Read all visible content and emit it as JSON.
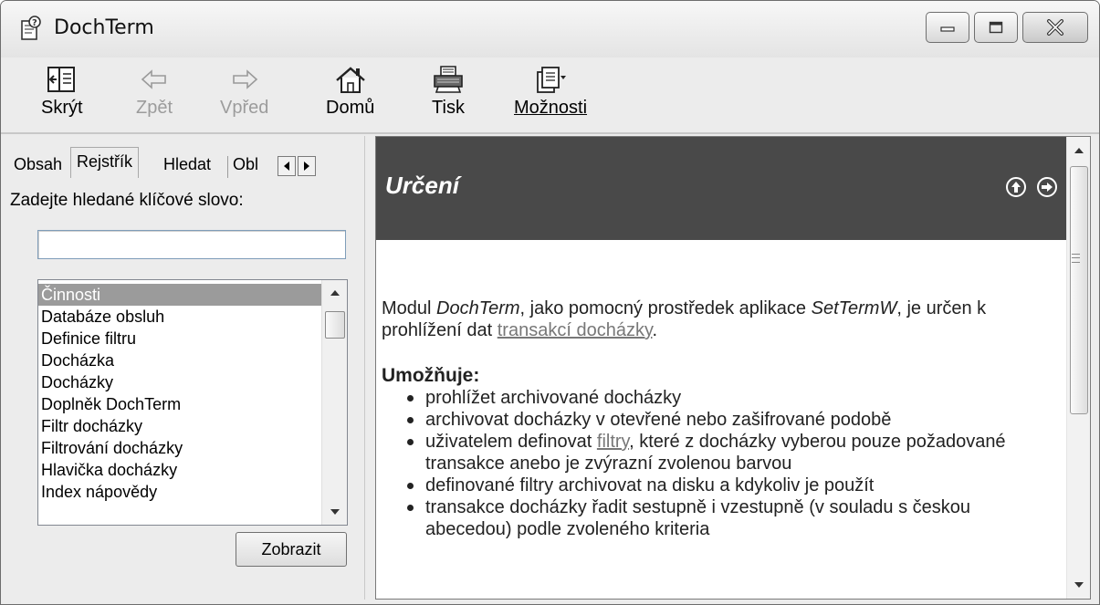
{
  "window": {
    "title": "DochTerm",
    "icon": "help-book-icon",
    "controls": [
      "minimize-icon",
      "maximize-icon",
      "close-icon"
    ]
  },
  "toolbar": {
    "hide_label": "Skrýt",
    "back_label": "Zpět",
    "forward_label": "Vpřed",
    "home_label": "Domů",
    "print_label": "Tisk",
    "options_label": "Možnosti"
  },
  "tabs": {
    "contents": "Obsah",
    "index": "Rejstřík",
    "search": "Hledat",
    "favorites": "Obl",
    "active": "index"
  },
  "index_panel": {
    "prompt": "Zadejte hledané klíčové slovo:",
    "keyword_value": "",
    "items": [
      "Činnosti",
      "Databáze obsluh",
      "Definice filtru",
      "Docházka",
      "Docházky",
      "Doplněk DochTerm",
      "Filtr docházky",
      "Filtrování docházky",
      "Hlavička docházky",
      "Index nápovědy"
    ],
    "selected_index": 0,
    "show_button": "Zobrazit"
  },
  "content": {
    "title": "Určení",
    "nav_icons": [
      "previous-topic-icon",
      "next-topic-icon"
    ],
    "intro": {
      "t1": "Modul ",
      "em1": "DochTerm",
      "t2": ", jako pomocný prostředek aplikace ",
      "em2": "SetTermW",
      "t3": ", je určen k prohlížení dat ",
      "link": "transakcí docházky",
      "t4": "."
    },
    "subheading": "Umožňuje:",
    "bullets": {
      "b1": "prohlížet archivované docházky",
      "b2": "archivovat docházky v otevřené nebo zašifrované podobě",
      "b3_pre": "uživatelem definovat ",
      "b3_link": "filtry",
      "b3_post": ", které z docházky vyberou pouze požadované transakce anebo je zvýrazní zvolenou barvou",
      "b4": "definované filtry archivovat na disku a kdykoliv je použít",
      "b5": "transakce docházky řadit sestupně i vzestupně (v souladu s českou abecedou) podle zvoleného kriteria"
    }
  },
  "colors": {
    "header_background": "#494949",
    "selection": "#9b9b9b",
    "link": "#777777"
  }
}
